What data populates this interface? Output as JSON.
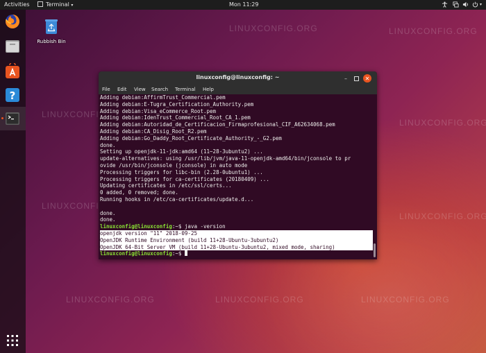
{
  "topbar": {
    "activities": "Activities",
    "app_menu": "Terminal",
    "clock": "Mon 11:29"
  },
  "desktop": {
    "rubbish_bin_label": "Rubbish Bin",
    "watermark": "LINUXCONFIG.ORG"
  },
  "terminal": {
    "title": "linuxconfig@linuxconfig: ~",
    "menu": [
      "File",
      "Edit",
      "View",
      "Search",
      "Terminal",
      "Help"
    ],
    "output_lines": [
      "Adding debian:AffirmTrust_Commercial.pem",
      "Adding debian:E-Tugra_Certification_Authority.pem",
      "Adding debian:Visa_eCommerce_Root.pem",
      "Adding debian:IdenTrust_Commercial_Root_CA_1.pem",
      "Adding debian:Autoridad_de_Certificacion_Firmaprofesional_CIF_A62634068.pem",
      "Adding debian:CA_Disig_Root_R2.pem",
      "Adding debian:Go_Daddy_Root_Certificate_Authority_-_G2.pem",
      "done.",
      "Setting up openjdk-11-jdk:amd64 (11~28-3ubuntu2) ...",
      "update-alternatives: using /usr/lib/jvm/java-11-openjdk-amd64/bin/jconsole to pr",
      "ovide /usr/bin/jconsole (jconsole) in auto mode",
      "Processing triggers for libc-bin (2.28-0ubuntu1) ...",
      "Processing triggers for ca-certificates (20180409) ...",
      "Updating certificates in /etc/ssl/certs...",
      "0 added, 0 removed; done.",
      "Running hooks in /etc/ca-certificates/update.d...",
      "",
      "done.",
      "done."
    ],
    "prompt": "linuxconfig@linuxconfig",
    "prompt_suffix": ":~$ ",
    "command": "java -version",
    "version_lines": [
      "openjdk version \"11\" 2018-09-25",
      "OpenJDK Runtime Environment (build 11+28-Ubuntu-3ubuntu2)",
      "OpenJDK 64-Bit Server VM (build 11+28-Ubuntu-3ubuntu2, mixed mode, sharing)"
    ]
  },
  "icons": {
    "dock": [
      "firefox-icon",
      "files-icon",
      "software-icon",
      "help-icon",
      "terminal-icon",
      "app-grid-icon"
    ]
  },
  "colors": {
    "terminal_bg": "#300a24",
    "prompt_green": "#8ae234",
    "titlebar": "#2f2f2f",
    "topbar": "#1d1d1d"
  }
}
